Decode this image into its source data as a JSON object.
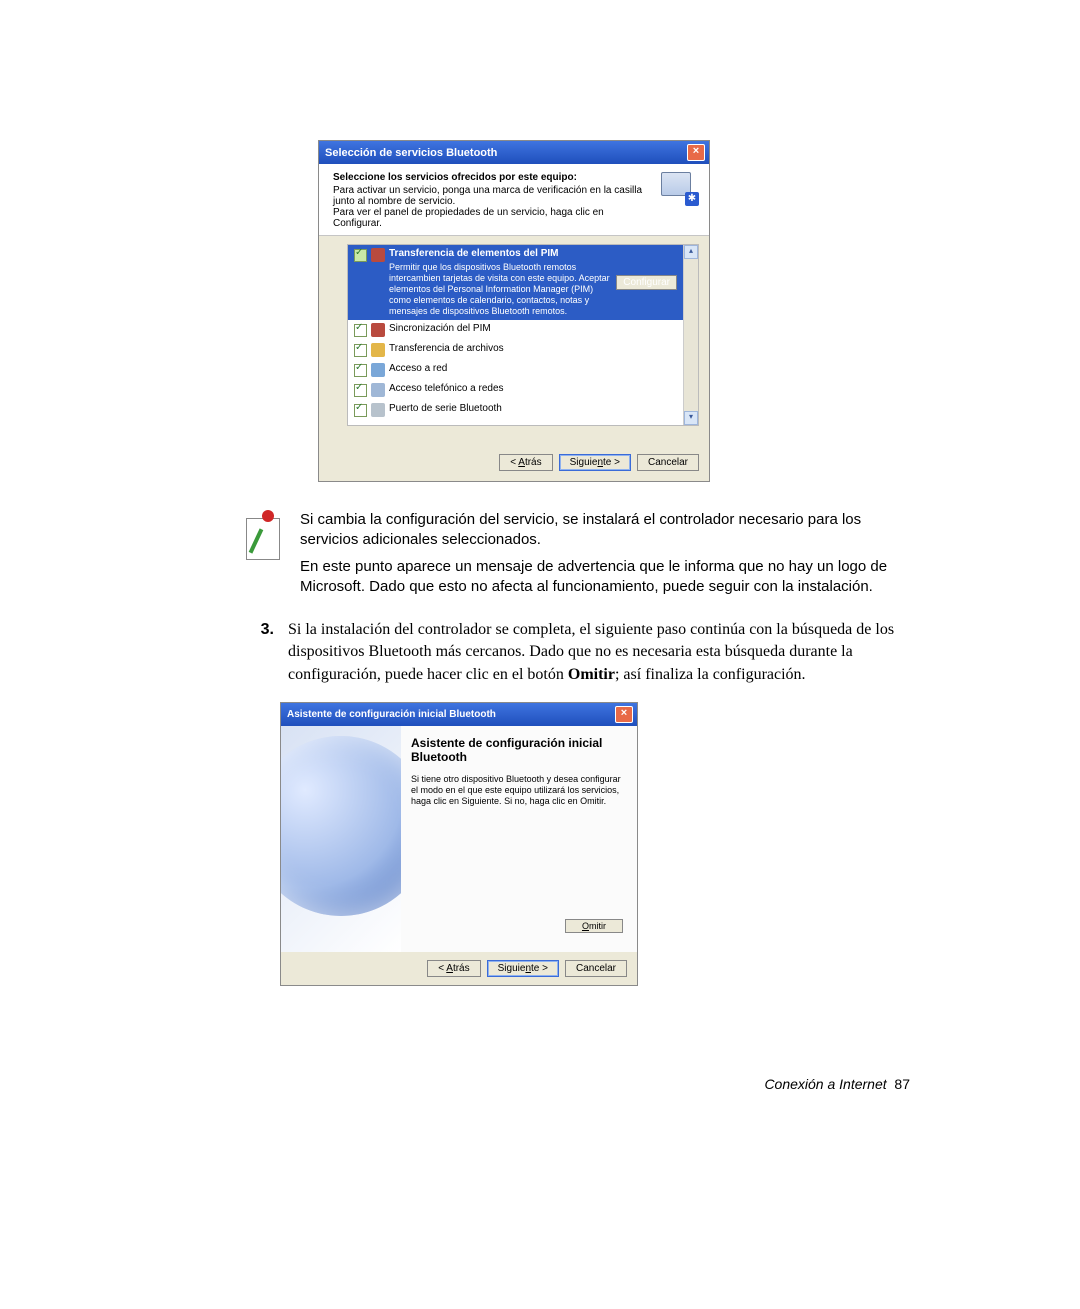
{
  "dialog1": {
    "title": "Selección de servicios Bluetooth",
    "close": "×",
    "heading": "Seleccione los servicios ofrecidos por este equipo:",
    "line1": "Para activar un servicio, ponga una marca de verificación en la casilla junto al nombre de servicio.",
    "line2": "Para ver el panel de propiedades de un servicio, haga clic en Configurar.",
    "bt_glyph": "✱",
    "selected": {
      "title": "Transferencia de elementos del PIM",
      "desc": "Permitir que los dispositivos Bluetooth remotos intercambien tarjetas de visita con este equipo. Aceptar elementos del Personal Information Manager (PIM) como elementos de calendario, contactos, notas y mensajes de dispositivos Bluetooth remotos.",
      "cfg": "Configurar"
    },
    "items": {
      "a": "Sincronización del PIM",
      "b": "Transferencia de archivos",
      "c": "Acceso a red",
      "d": "Acceso telefónico a redes",
      "e": "Puerto de serie Bluetooth"
    },
    "buttons": {
      "back_pre": "< ",
      "back_u": "A",
      "back_post": "trás",
      "next_pre": "Siguie",
      "next_u": "n",
      "next_post": "te >",
      "cancel": "Cancelar"
    }
  },
  "note": {
    "p1": "Si cambia la configuración del servicio, se instalará el controlador necesario para los servicios adicionales seleccionados.",
    "p2": "En este punto aparece un mensaje de advertencia que le informa que no hay un logo de Microsoft. Dado que esto no afecta al funcionamiento, puede seguir con la instalación."
  },
  "step3": {
    "num": "3.",
    "pre": "Si la instalación del controlador se completa, el siguiente paso continúa con la búsqueda de los dispositivos Bluetooth más cercanos. Dado que no es necesaria esta búsqueda durante la configuración, puede hacer clic en el botón ",
    "bold": "Omitir",
    "post": "; así finaliza la configuración."
  },
  "dialog2": {
    "title": "Asistente de configuración inicial Bluetooth",
    "close": "×",
    "heading": "Asistente de configuración inicial Bluetooth",
    "para": "Si tiene otro dispositivo Bluetooth y desea configurar el modo en el que este equipo utilizará los servicios, haga clic en Siguiente. Si no, haga clic en Omitir.",
    "omit_u": "O",
    "omit_post": "mitir",
    "buttons": {
      "back_pre": "< ",
      "back_u": "A",
      "back_post": "trás",
      "next_pre": "Siguie",
      "next_u": "n",
      "next_post": "te >",
      "cancel": "Cancelar"
    }
  },
  "footer": {
    "label": "Conexión a Internet",
    "page": "87"
  }
}
